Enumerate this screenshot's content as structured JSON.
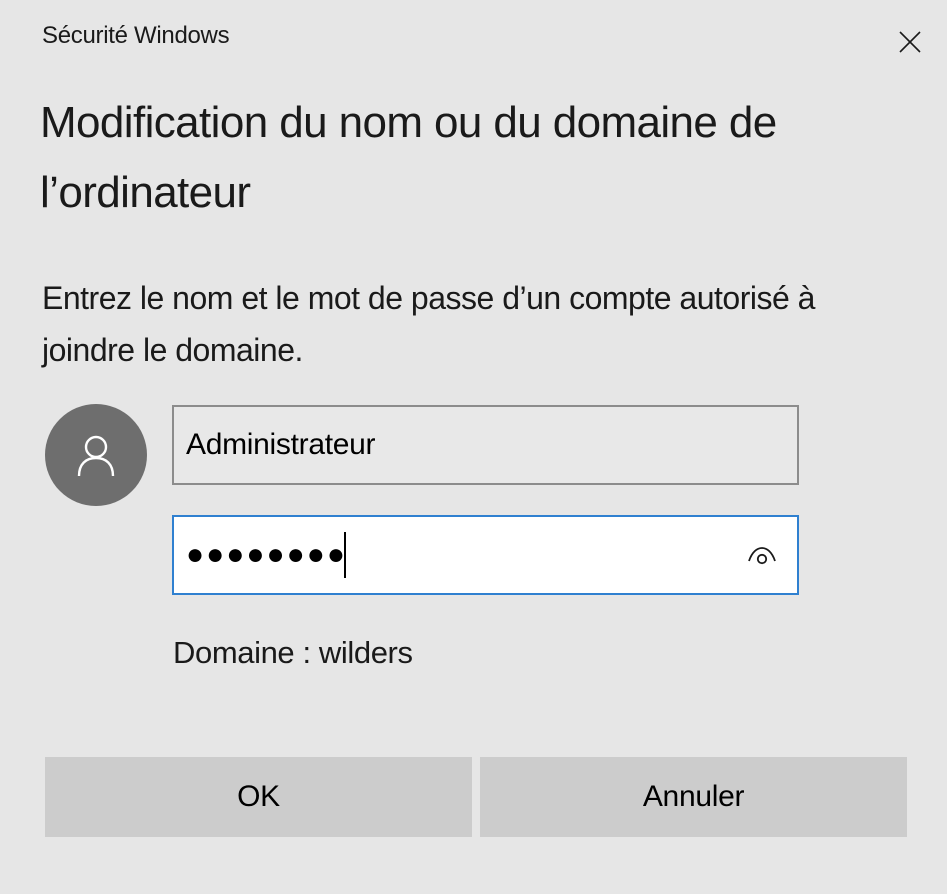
{
  "window": {
    "app_title": "Sécurité Windows",
    "close_icon": "close-icon"
  },
  "dialog": {
    "heading": "Modification du nom ou du domaine de l’ordinateur",
    "instructions": "Entrez le nom et le mot de passe d’un compte autorisé à joindre le domaine.",
    "avatar_icon": "user-icon"
  },
  "form": {
    "username": {
      "value": "Administrateur"
    },
    "password": {
      "masked_value": "●●●●●●●●",
      "reveal_icon": "eye-icon"
    },
    "domain_text": "Domaine : wilders"
  },
  "buttons": {
    "ok_label": "OK",
    "cancel_label": "Annuler"
  },
  "colors": {
    "background": "#e6e6e6",
    "button_bg": "#cccccc",
    "focus_border": "#2f80d0",
    "avatar_bg": "#6e6e6e"
  }
}
